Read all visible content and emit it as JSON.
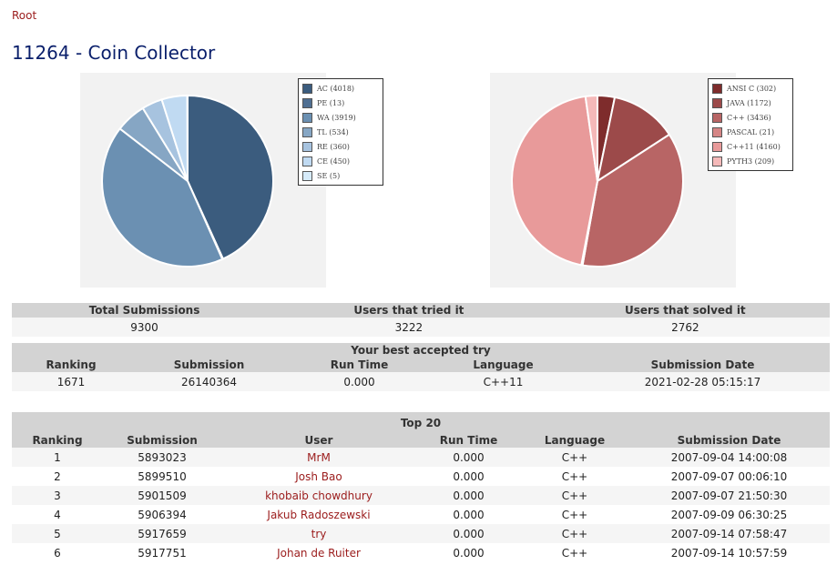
{
  "breadcrumb": "Root",
  "title": "11264 - Coin Collector",
  "chart_data": [
    {
      "type": "pie",
      "legend_position": "right",
      "slices": [
        {
          "label": "AC (4018)",
          "name": "AC",
          "value": 4018,
          "color": "#3b5c7e"
        },
        {
          "label": "PE (13)",
          "name": "PE",
          "value": 13,
          "color": "#4f6f92"
        },
        {
          "label": "WA (3919)",
          "name": "WA",
          "value": 3919,
          "color": "#6b90b2"
        },
        {
          "label": "TL (534)",
          "name": "TL",
          "value": 534,
          "color": "#86a6c4"
        },
        {
          "label": "RE (360)",
          "name": "RE",
          "value": 360,
          "color": "#a7c3df"
        },
        {
          "label": "CE (450)",
          "name": "CE",
          "value": 450,
          "color": "#c0daf2"
        },
        {
          "label": "SE (5)",
          "name": "SE",
          "value": 5,
          "color": "#d6ebfa"
        }
      ]
    },
    {
      "type": "pie",
      "legend_position": "right",
      "slices": [
        {
          "label": "ANSI C (302)",
          "name": "ANSI C",
          "value": 302,
          "color": "#7e2c2c"
        },
        {
          "label": "JAVA (1172)",
          "name": "JAVA",
          "value": 1172,
          "color": "#9c4a4a"
        },
        {
          "label": "C++ (3436)",
          "name": "C++",
          "value": 3436,
          "color": "#b86565"
        },
        {
          "label": "PASCAL (21)",
          "name": "PASCAL",
          "value": 21,
          "color": "#d58585"
        },
        {
          "label": "C++11 (4160)",
          "name": "C++11",
          "value": 4160,
          "color": "#e89a9a"
        },
        {
          "label": "PYTH3 (209)",
          "name": "PYTH3",
          "value": 209,
          "color": "#f5b9b9"
        }
      ]
    }
  ],
  "summary": {
    "headers": [
      "Total Submissions",
      "Users that tried it",
      "Users that solved it"
    ],
    "values": [
      "9300",
      "3222",
      "2762"
    ]
  },
  "best": {
    "caption": "Your best accepted try",
    "headers": [
      "Ranking",
      "Submission",
      "Run Time",
      "Language",
      "Submission Date"
    ],
    "row": [
      "1671",
      "26140364",
      "0.000",
      "C++11",
      "2021-02-28 05:15:17"
    ]
  },
  "top": {
    "caption": "Top 20",
    "headers": [
      "Ranking",
      "Submission",
      "User",
      "Run Time",
      "Language",
      "Submission Date"
    ],
    "rows": [
      [
        "1",
        "5893023",
        "MrM",
        "0.000",
        "C++",
        "2007-09-04 14:00:08"
      ],
      [
        "2",
        "5899510",
        "Josh Bao",
        "0.000",
        "C++",
        "2007-09-07 00:06:10"
      ],
      [
        "3",
        "5901509",
        "khobaib chowdhury",
        "0.000",
        "C++",
        "2007-09-07 21:50:30"
      ],
      [
        "4",
        "5906394",
        "Jakub Radoszewski",
        "0.000",
        "C++",
        "2007-09-09 06:30:25"
      ],
      [
        "5",
        "5917659",
        "try",
        "0.000",
        "C++",
        "2007-09-14 07:58:47"
      ],
      [
        "6",
        "5917751",
        "Johan de Ruiter",
        "0.000",
        "C++",
        "2007-09-14 10:57:59"
      ]
    ]
  }
}
